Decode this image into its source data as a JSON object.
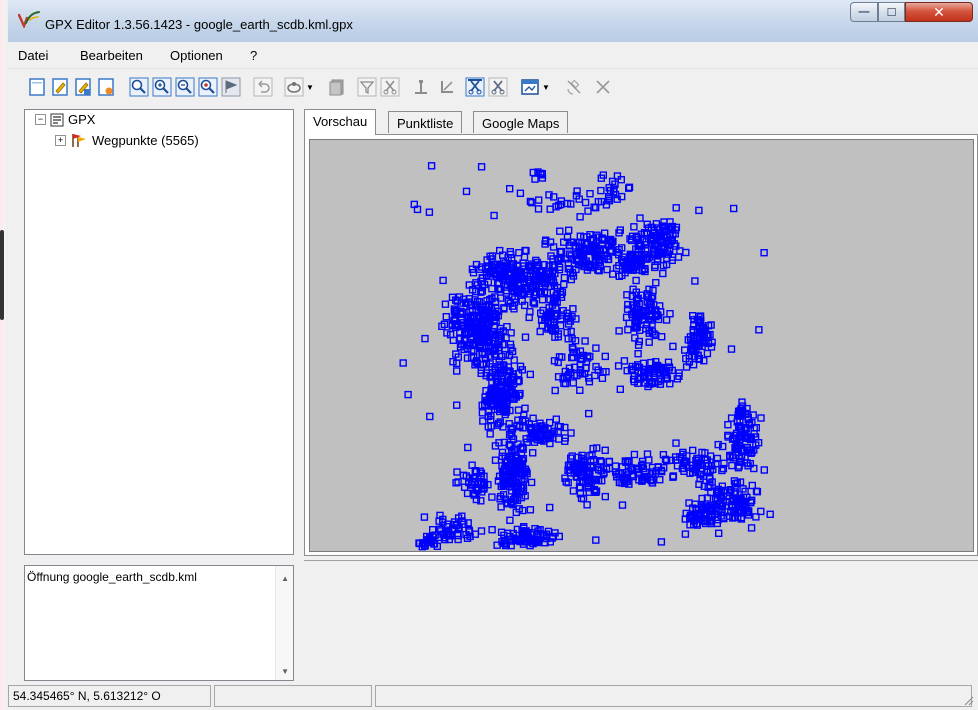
{
  "window": {
    "title": "GPX Editor 1.3.56.1423 - google_earth_scdb.kml.gpx",
    "buttons": {
      "minimize": "—",
      "maximize": "☐",
      "close": "✕"
    }
  },
  "menu": {
    "items": [
      "Datei",
      "Bearbeiten",
      "Optionen",
      "?"
    ]
  },
  "tree": {
    "root_label": "GPX",
    "child_label": "Wegpunkte (5565)"
  },
  "log": {
    "message": "Öffnung google_earth_scdb.kml"
  },
  "tabs": [
    "Vorschau",
    "Punktliste",
    "Google Maps"
  ],
  "active_tab": "Vorschau",
  "preview": {
    "background": "#c0c0c0",
    "marker_color": "#0000ff",
    "marker_shape": "hollow-square",
    "point_count": 5565
  },
  "status": {
    "coords": "54.345465° N, 5.613212° O",
    "pane2": "",
    "pane3": ""
  },
  "colors": {
    "titlebar": "#c6d6ea",
    "close_button": "#c0311b",
    "toolbar_icon": "#3a78c8"
  }
}
